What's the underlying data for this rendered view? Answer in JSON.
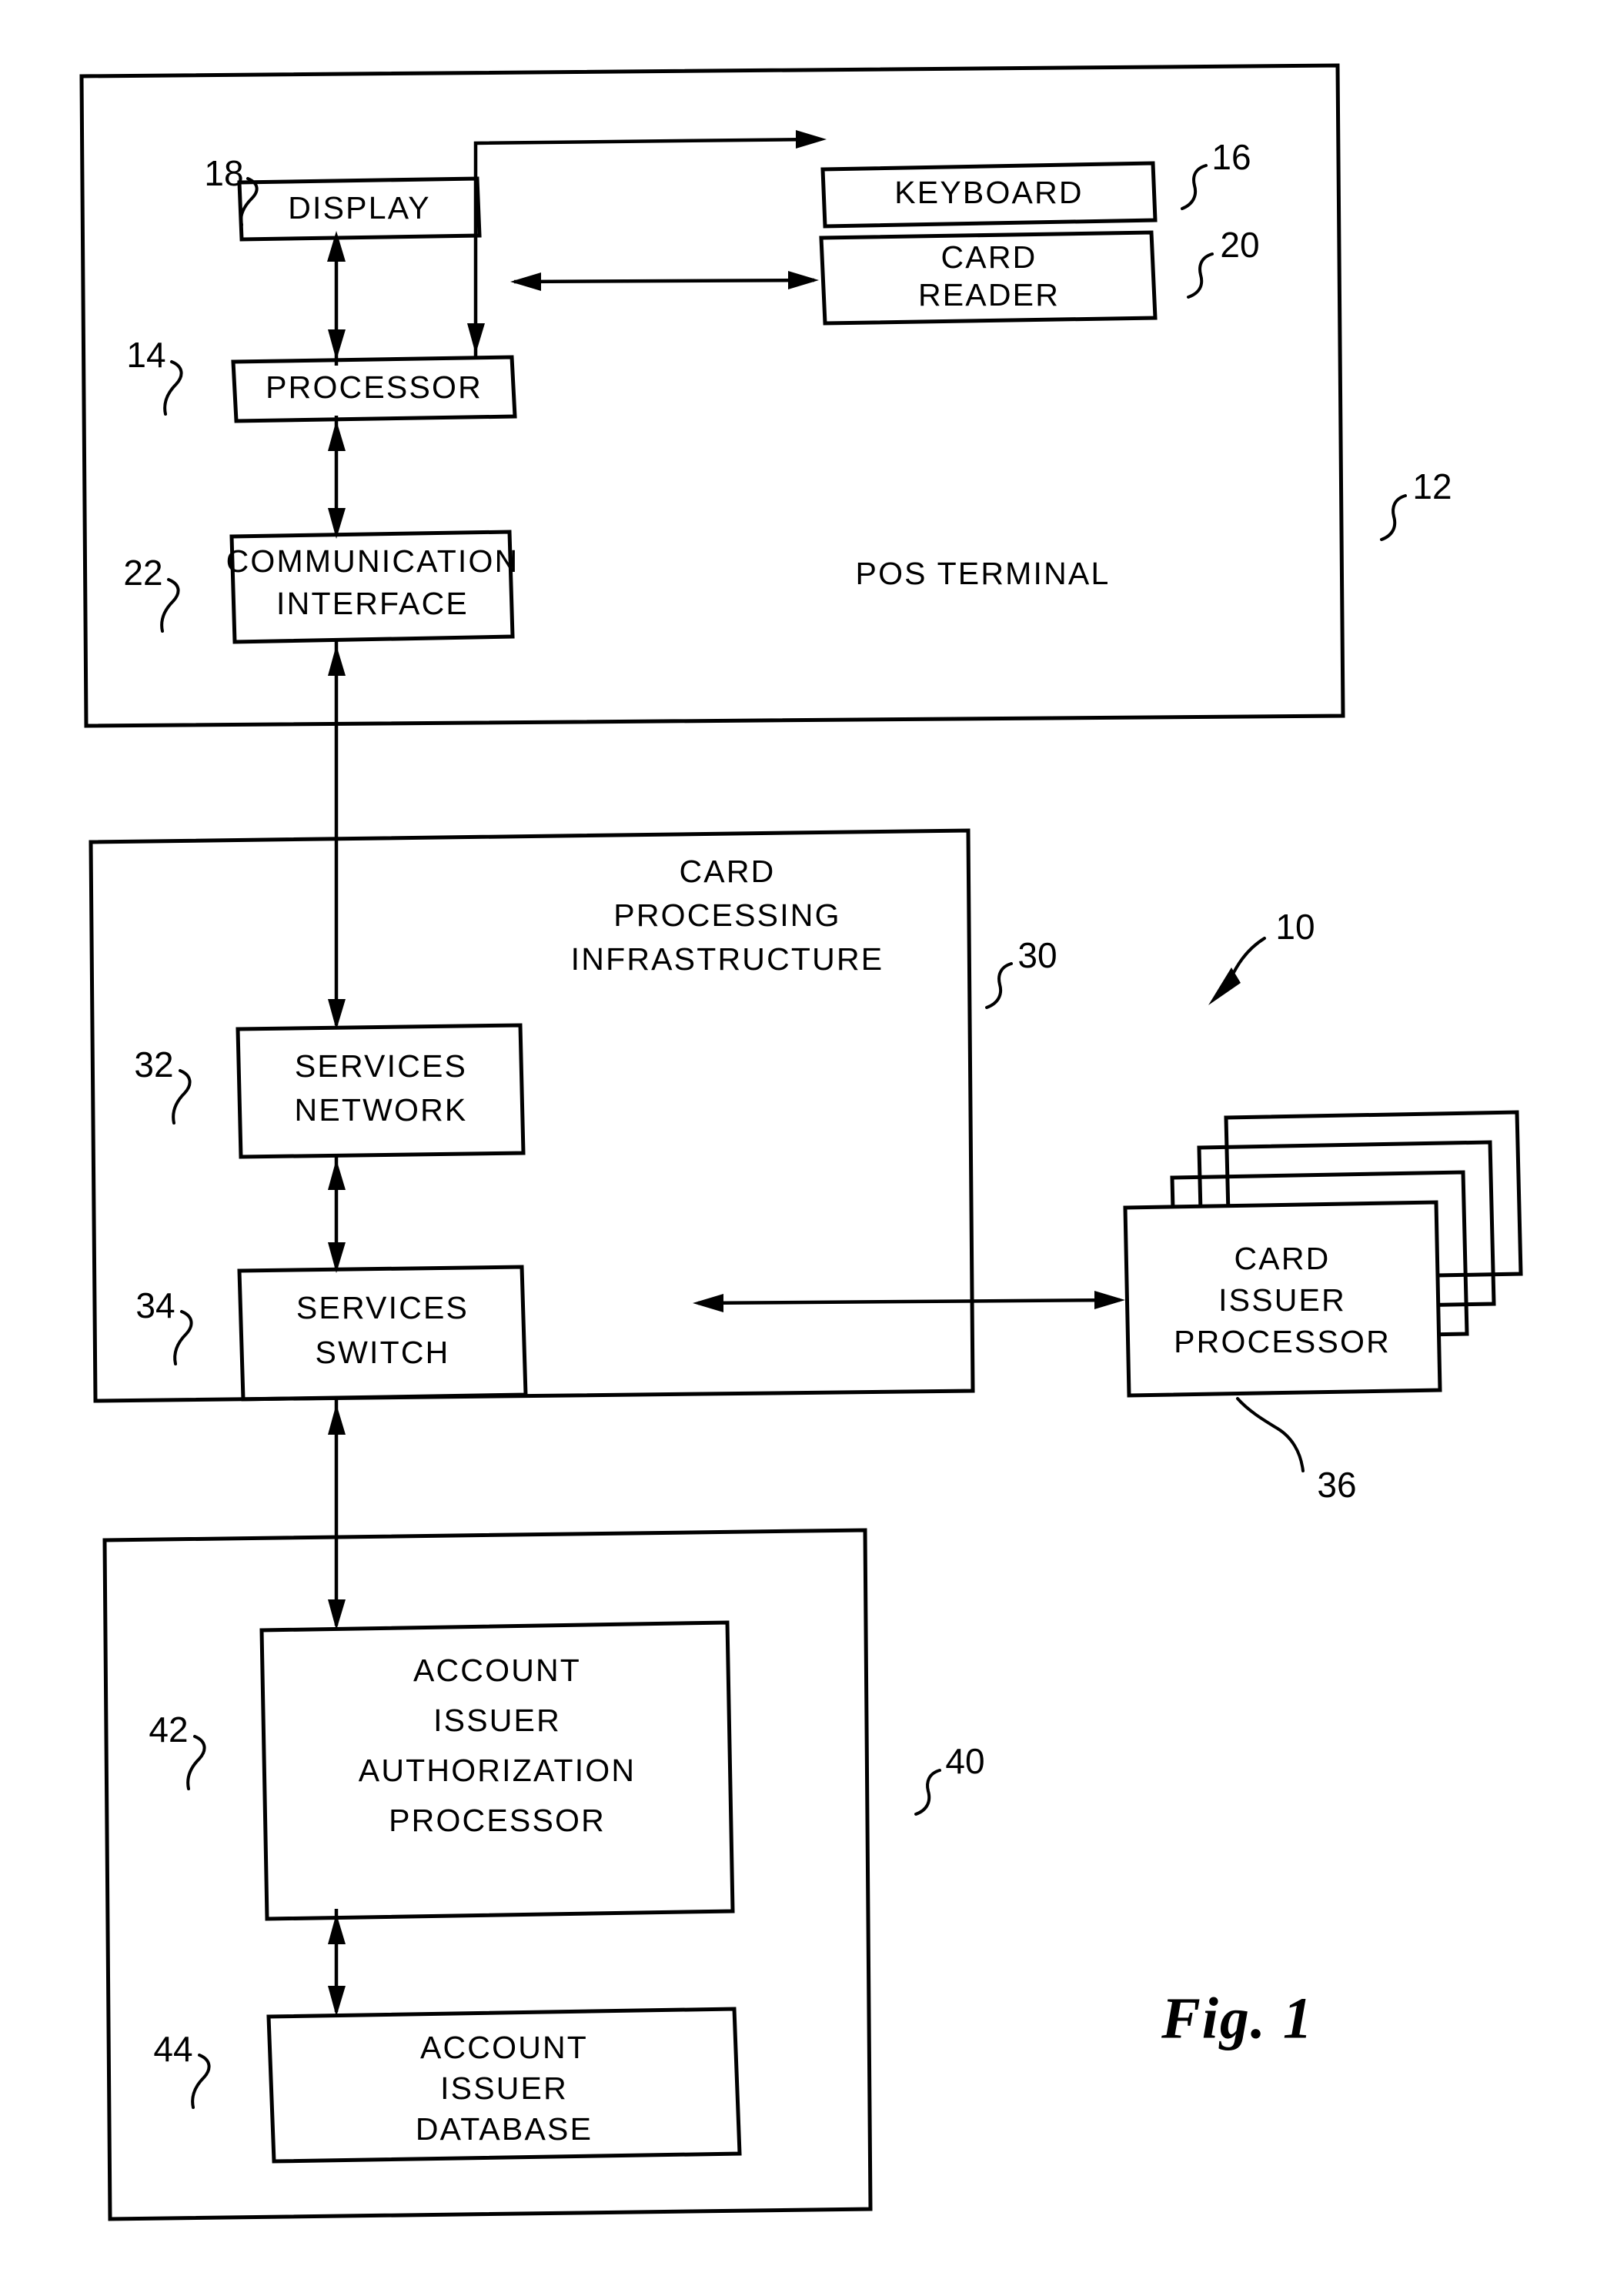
{
  "figure": {
    "caption": "Fig. 1",
    "system_ref": "10"
  },
  "containers": [
    {
      "id": "pos-terminal",
      "title": "POS TERMINAL",
      "ref": "12"
    },
    {
      "id": "card-processing-infrastructure",
      "title_line1": "CARD",
      "title_line2": "PROCESSING",
      "title_line3": "INFRASTRUCTURE",
      "ref": "30"
    },
    {
      "id": "account-issuer",
      "ref": "40"
    }
  ],
  "blocks": [
    {
      "id": "display",
      "label": "DISPLAY",
      "ref": "18"
    },
    {
      "id": "keyboard",
      "label": "KEYBOARD",
      "ref": "16"
    },
    {
      "id": "processor",
      "label": "PROCESSOR",
      "ref": "14"
    },
    {
      "id": "card-reader",
      "label_line1": "CARD",
      "label_line2": "READER",
      "ref": "20"
    },
    {
      "id": "communication-interface",
      "label_line1": "COMMUNICATION",
      "label_line2": "INTERFACE",
      "ref": "22"
    },
    {
      "id": "services-network",
      "label_line1": "SERVICES",
      "label_line2": "NETWORK",
      "ref": "32"
    },
    {
      "id": "services-switch",
      "label_line1": "SERVICES",
      "label_line2": "SWITCH",
      "ref": "34"
    },
    {
      "id": "card-issuer-processor",
      "label_line1": "CARD",
      "label_line2": "ISSUER",
      "label_line3": "PROCESSOR",
      "ref": "36"
    },
    {
      "id": "account-issuer-authorization-processor",
      "label_line1": "ACCOUNT",
      "label_line2": "ISSUER",
      "label_line3": "AUTHORIZATION",
      "label_line4": "PROCESSOR",
      "ref": "42"
    },
    {
      "id": "account-issuer-database",
      "label_line1": "ACCOUNT",
      "label_line2": "ISSUER",
      "label_line3": "DATABASE",
      "ref": "44"
    }
  ],
  "colors": {
    "ink": "#000000",
    "paper": "#ffffff"
  }
}
